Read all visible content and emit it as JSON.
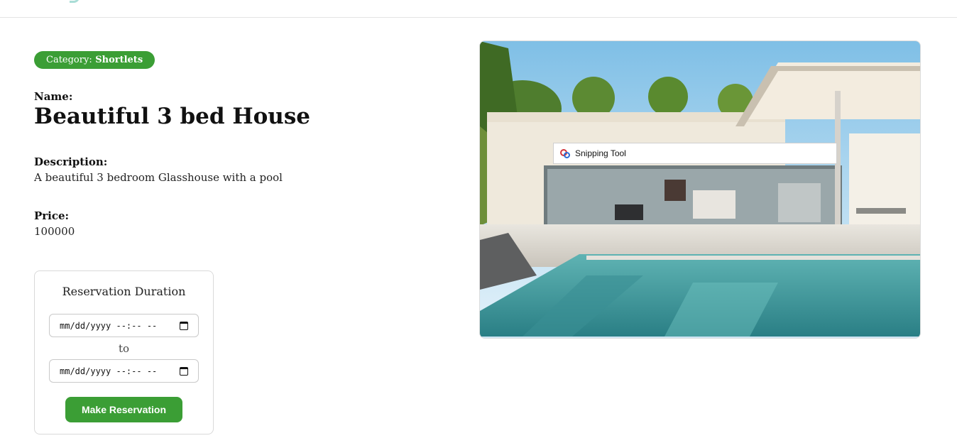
{
  "listing": {
    "category_prefix": "Category:",
    "category_value": "Shortlets",
    "name_label": "Name:",
    "name": "Beautiful 3 bed House",
    "description_label": "Description:",
    "description": "A beautiful 3 bedroom Glasshouse with a pool",
    "price_label": "Price:",
    "price": "100000"
  },
  "reservation": {
    "title": "Reservation Duration",
    "start_placeholder": "mm/dd/yyyy --:-- --",
    "separator": "to",
    "end_placeholder": "mm/dd/yyyy --:-- --",
    "button_label": "Make Reservation"
  },
  "image": {
    "overlay_label": "Snipping Tool",
    "overlay_icon": "snipping-tool-icon"
  },
  "colors": {
    "accent": "#3b9e35",
    "pool": "#2f8f8b",
    "sky": "#bfe0f3"
  }
}
